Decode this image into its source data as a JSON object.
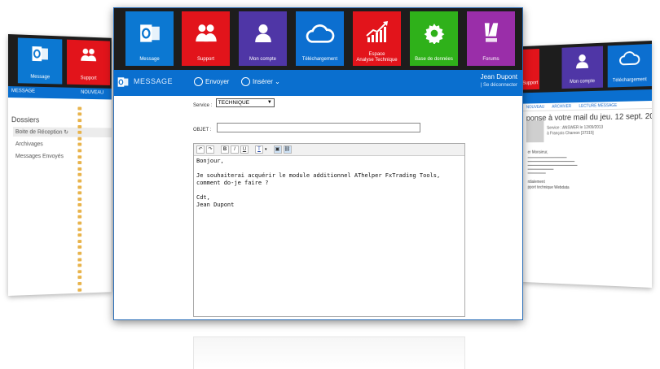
{
  "main": {
    "tiles": [
      {
        "label": "Message",
        "color": "#0c78d2",
        "icon": "outlook-icon"
      },
      {
        "label": "Support",
        "color": "#e2141b",
        "icon": "users-icon"
      },
      {
        "label": "Mon compte",
        "color": "#4f36a6",
        "icon": "user-icon"
      },
      {
        "label": "Téléchargement",
        "color": "#0c6fd0",
        "icon": "cloud-icon"
      },
      {
        "label": "Espace\nAnalyse Technique",
        "color": "#e2141b",
        "icon": "chart-icon"
      },
      {
        "label": "Base de données",
        "color": "#2fb11a",
        "icon": "gear-icon"
      },
      {
        "label": "Forums",
        "color": "#9a2ea9",
        "icon": "forum-icon"
      }
    ],
    "toolbar": {
      "title": "MESSAGE",
      "send_label": "Envoyer",
      "insert_label": "Insérer ⌄",
      "user_name": "Jean Dupont",
      "logout_label": "| Se déconnecter"
    },
    "form": {
      "service_label": "Service :",
      "service_value": "TECHNIQUE",
      "objet_label": "OBJET :",
      "objet_value": "",
      "body_lines": [
        "Bonjour,",
        "",
        "Je souhaiterai acquérir le module additionnel AThelper FxTrading Tools, comment do-je faire ?",
        "",
        "Cdt,",
        "Jean Dupont"
      ]
    }
  },
  "left": {
    "tiles": [
      {
        "label": "Message",
        "color": "#0c78d2"
      },
      {
        "label": "Support",
        "color": "#e2141b"
      }
    ],
    "bar_title": "MESSAGE",
    "new_label": "NOUVEAU",
    "side_title": "Dossiers",
    "side_items": [
      "Boite de Réception ↻",
      "Archivages",
      "Messages Envoyés"
    ]
  },
  "right": {
    "tiles": [
      {
        "label": "Support",
        "color": "#e2141b"
      },
      {
        "label": "Mon compte",
        "color": "#4f36a6"
      },
      {
        "label": "Téléchargement",
        "color": "#0c6fd0"
      }
    ],
    "sub_items": [
      "NOUVEAU",
      "ARCHIVER",
      "LECTURE MESSAGE"
    ],
    "title": "ponse à votre mail du jeu. 12 sept. 20",
    "meta1": "Service : ANSWER le 12/09/2013",
    "meta2": "à François Chareon [37315]",
    "greeting": "er Monsieur,",
    "closing": "rdialement",
    "signature": "pport technique Webdata"
  }
}
